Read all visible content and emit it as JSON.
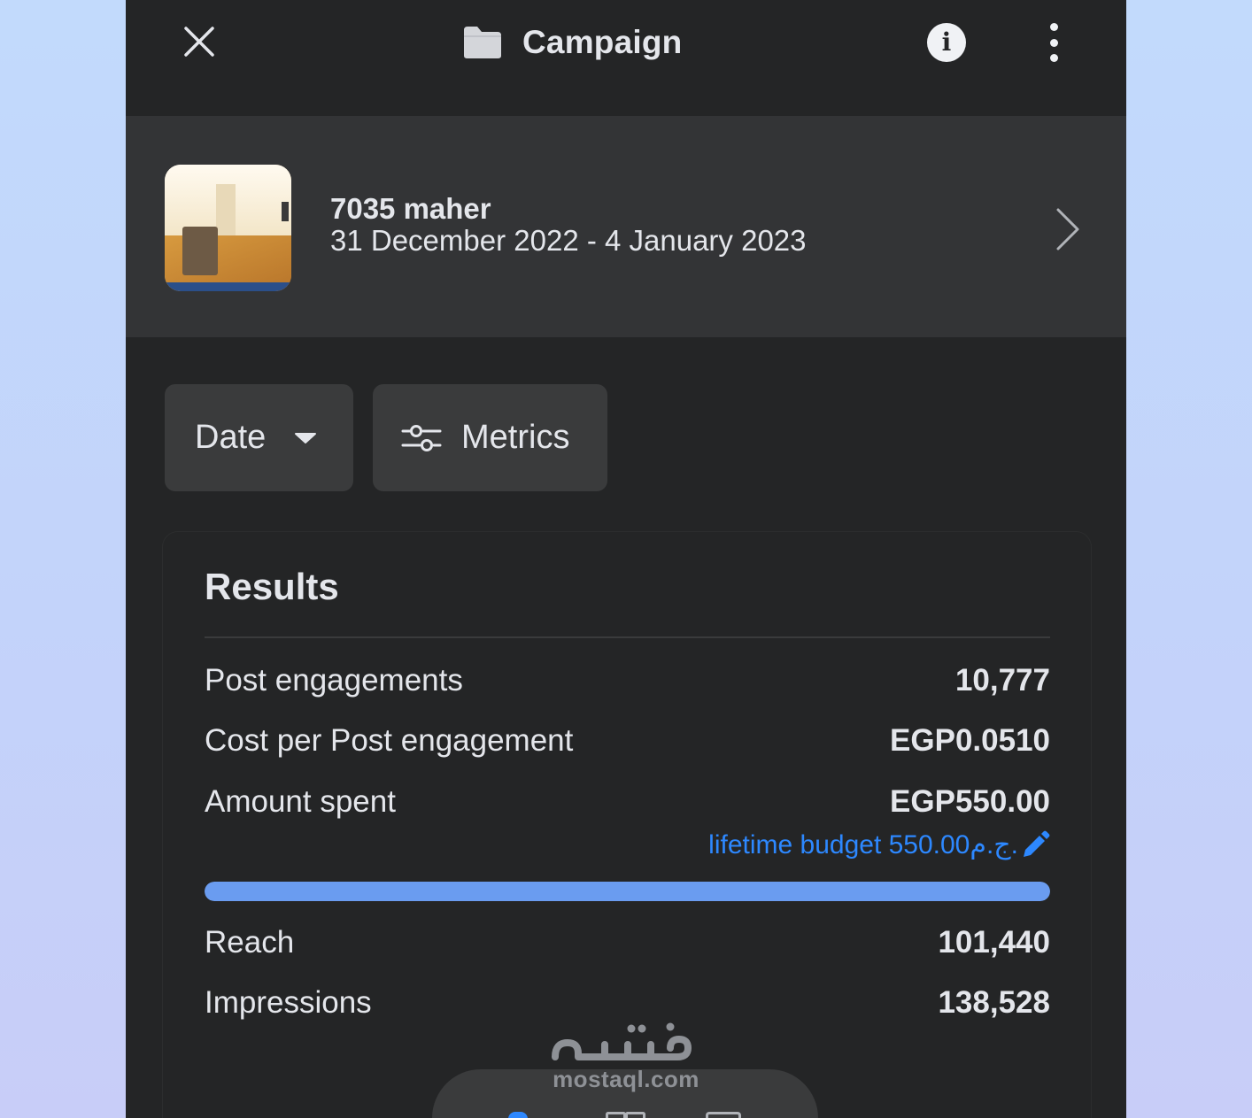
{
  "header": {
    "title": "Campaign",
    "close_icon": "close-icon",
    "folder_icon": "folder-icon",
    "info_icon": "info-icon",
    "more_icon": "more-vertical-icon"
  },
  "campaign": {
    "name": "7035 maher",
    "dates": "31 December 2022 - 4 January 2023",
    "chevron_icon": "chevron-right-icon"
  },
  "filters": {
    "date_label": "Date",
    "metrics_label": "Metrics"
  },
  "results": {
    "title": "Results",
    "rows": [
      {
        "label": "Post engagements",
        "value": "10,777"
      },
      {
        "label": "Cost per Post engagement",
        "value": "EGP0.0510"
      },
      {
        "label": "Amount spent",
        "value": "EGP550.00"
      }
    ],
    "budget_text": "lifetime budget 550.00ج.م.",
    "budget_progress": 1.0,
    "rows_after": [
      {
        "label": "Reach",
        "value": "101,440"
      },
      {
        "label": "Impressions",
        "value": "138,528"
      }
    ]
  },
  "watermark": {
    "text": "mostaql.com",
    "logo_text": "مستقل"
  },
  "colors": {
    "background": "#242526",
    "summary_bg": "#333436",
    "button_bg": "#3a3b3c",
    "text": "#e4e6eb",
    "link": "#2d88ff",
    "progress": "#6a9cf0"
  }
}
